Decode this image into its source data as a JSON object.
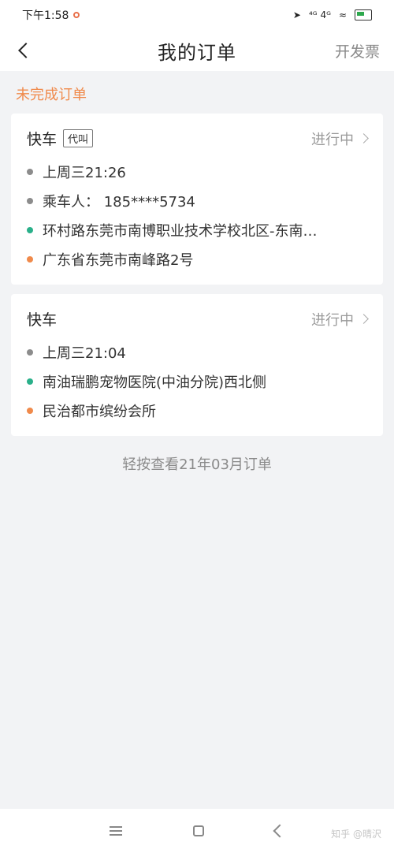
{
  "status": {
    "time": "下午1:58",
    "signal": "⁴ᴳ 4ᴳ",
    "battery_level": 0.5
  },
  "header": {
    "title": "我的订单",
    "action_label": "开发票"
  },
  "section": {
    "title": "未完成订单"
  },
  "orders": [
    {
      "type": "快车",
      "tag": "代叫",
      "status": "进行中",
      "time": "上周三21:26",
      "passenger": "乘车人： 185****5734",
      "from": "环村路东莞市南博职业技术学校北区-东南…",
      "to": "广东省东莞市南峰路2号"
    },
    {
      "type": "快车",
      "status": "进行中",
      "time": "上周三21:04",
      "from": "南油瑞鹏宠物医院(中油分院)西北侧",
      "to": "民治都市缤纷会所"
    }
  ],
  "footer": {
    "history_link": "轻按查看21年03月订单"
  },
  "watermark": "知乎 @晴沢",
  "colors": {
    "accent": "#f08a4b",
    "start_dot": "#2ab08a",
    "time_dot": "#8c8c8c"
  }
}
